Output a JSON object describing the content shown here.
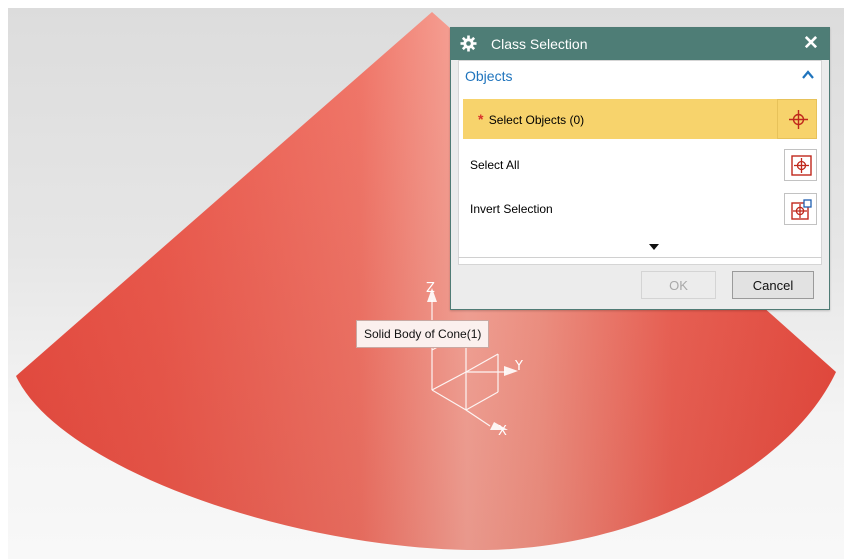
{
  "dialog": {
    "title": "Class Selection",
    "title_icon": "gear-icon",
    "close_icon": "close-icon",
    "group": {
      "title": "Objects",
      "collapse_icon": "chevron-up-icon",
      "rows": [
        {
          "label": "Select Objects (0)",
          "required_mark": "*",
          "icon": "crosshair-icon",
          "highlighted": true
        },
        {
          "label": "Select All",
          "icon": "select-all-icon"
        },
        {
          "label": "Invert Selection",
          "icon": "invert-selection-icon"
        }
      ]
    },
    "more_icon": "expand-down-icon",
    "buttons": {
      "ok": "OK",
      "cancel": "Cancel"
    },
    "ok_enabled": false
  },
  "viewport": {
    "tooltip": "Solid Body of Cone(1)",
    "axes": {
      "x": "X",
      "y": "Y",
      "z": "Z"
    }
  },
  "colors": {
    "titlebar": "#4e7d76",
    "highlight_row": "#f7d36c",
    "group_title": "#1f74bd",
    "cone_base": "#ec5a4b",
    "cone_highlight": "#f4a394",
    "required_mark": "#d9312b"
  }
}
